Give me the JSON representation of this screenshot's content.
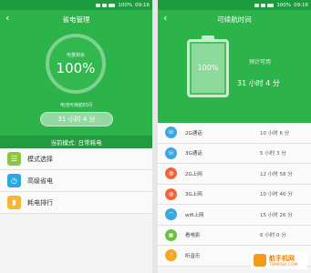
{
  "left": {
    "status": {
      "battery": "100%",
      "time": "09:16"
    },
    "title": "省电管理",
    "circle_caption": "电量剩余",
    "percent": "100%",
    "remaining_caption": "电池可续航时间",
    "remaining_value": "31 小时 4 分",
    "mode_label": "当前模式: 日常耗电",
    "menu": [
      {
        "label": "模式选择",
        "icon": "list-icon",
        "color": "#8cc63f"
      },
      {
        "label": "高级省电",
        "icon": "clock-icon",
        "color": "#29a9e1"
      },
      {
        "label": "耗电排行",
        "icon": "bar-chart-icon",
        "color": "#f7b731"
      }
    ]
  },
  "right": {
    "status": {
      "battery": "100%",
      "time": "09:16"
    },
    "title": "可续航时间",
    "battery_percent": "100%",
    "battery_level": 1.0,
    "available_label": "预计可用",
    "available_value": "31 小时 4 分",
    "rows": [
      {
        "label": "2G通话",
        "value": "10 小时 6 分",
        "icon": "phone-icon",
        "color": "#3aa7e0"
      },
      {
        "label": "3G通话",
        "value": "5 小时 3 分",
        "icon": "phone-icon",
        "color": "#3aa7e0"
      },
      {
        "label": "2G上网",
        "value": "12 小时 58 分",
        "icon": "globe-icon",
        "color": "#f0663a"
      },
      {
        "label": "3G上网",
        "value": "10 小时 40 分",
        "icon": "globe-icon",
        "color": "#f0663a"
      },
      {
        "label": "wifi上网",
        "value": "15 小时 26 分",
        "icon": "wifi-icon",
        "color": "#3aa7e0"
      },
      {
        "label": "看电影",
        "value": "6 小时 0 分",
        "icon": "film-icon",
        "color": "#6dbf3e"
      },
      {
        "label": "听音乐",
        "value": "",
        "icon": "music-icon",
        "color": "#f5a623"
      }
    ]
  },
  "watermark": {
    "line1": "航手机网",
    "line2": "TOMPDA.COM"
  }
}
